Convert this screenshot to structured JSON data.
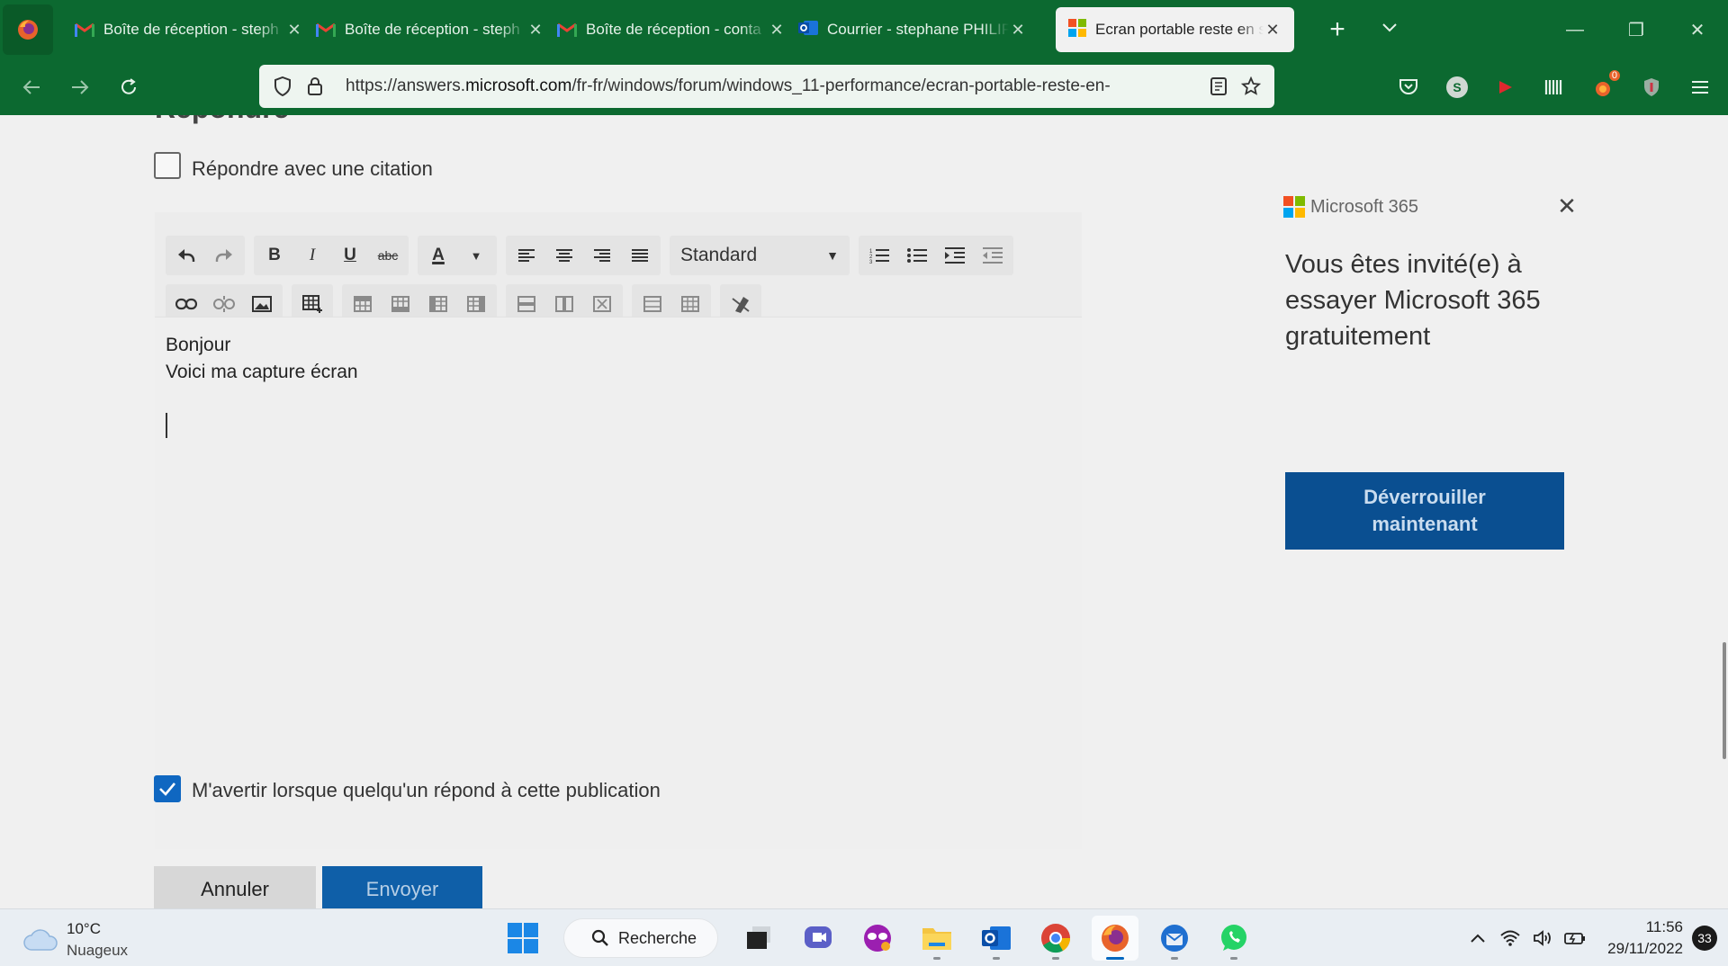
{
  "browser": {
    "tabs": [
      {
        "title": "Boîte de réception - steph",
        "icon": "gmail-icon",
        "active": false
      },
      {
        "title": "Boîte de réception - steph",
        "icon": "gmail-icon",
        "active": false
      },
      {
        "title": "Boîte de réception - conta",
        "icon": "gmail-icon",
        "active": false
      },
      {
        "title": "Courrier - stephane PHILIP",
        "icon": "outlook-icon",
        "active": false
      },
      {
        "title": "Ecran portable reste en so",
        "icon": "microsoft-icon",
        "active": true
      }
    ],
    "url_prefix": "https://answers.",
    "url_domain": "microsoft.com",
    "url_path": "/fr-fr/windows/forum/windows_11-performance/ecran-portable-reste-en-",
    "extension_badge": "0",
    "avatar_letter": "S",
    "accent_color": "#0c6930"
  },
  "reply_form": {
    "heading": "Répondre",
    "quote_label": "Répondre avec une citation",
    "format_select": "Standard",
    "body_lines": [
      "Bonjour",
      "Voici ma capture écran"
    ],
    "notify_label": "M'avertir lorsque quelqu'un répond à cette publication",
    "notify_checked": true,
    "cancel_label": "Annuler",
    "send_label": "Envoyer",
    "toolbar_bold": "B",
    "toolbar_italic": "I",
    "toolbar_underline": "U",
    "toolbar_strike": "abc",
    "toolbar_fontcolor": "A"
  },
  "promo": {
    "brand": "Microsoft 365",
    "text": "Vous êtes invité(e) à essayer Microsoft 365 gratuitement",
    "button_line1": "Déverrouiller",
    "button_line2": "maintenant",
    "button_color": "#0a4f91"
  },
  "taskbar": {
    "weather_temp": "10°C",
    "weather_desc": "Nuageux",
    "search_label": "Recherche",
    "time": "11:56",
    "date": "29/11/2022",
    "notification_count": "33"
  }
}
